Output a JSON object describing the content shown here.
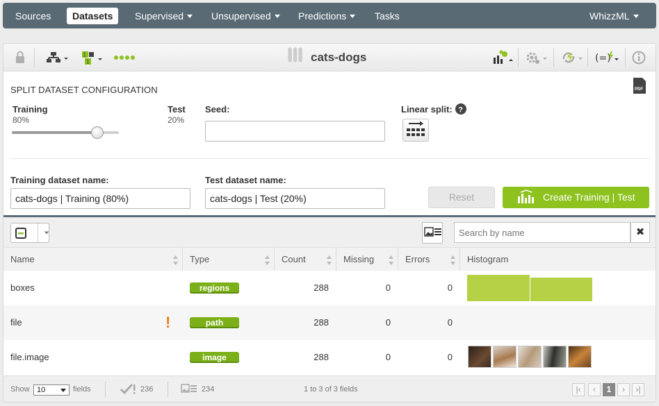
{
  "nav": {
    "sources": "Sources",
    "datasets": "Datasets",
    "supervised": "Supervised",
    "unsupervised": "Unsupervised",
    "predictions": "Predictions",
    "tasks": "Tasks",
    "whizzml": "WhizzML"
  },
  "toolbar": {
    "title": "cats-dogs",
    "status_dots": 4
  },
  "config": {
    "section_title": "SPLIT DATASET CONFIGURATION",
    "training_label": "Training",
    "training_pct": "80%",
    "training_fraction": 0.8,
    "test_label": "Test",
    "test_pct": "20%",
    "seed_label": "Seed:",
    "seed_value": "",
    "linear_split_label": "Linear split:",
    "training_name_label": "Training dataset name:",
    "training_name_value": "cats-dogs | Training (80%)",
    "test_name_label": "Test dataset name:",
    "test_name_value": "cats-dogs | Test (20%)",
    "reset_label": "Reset",
    "create_label": "Create Training | Test"
  },
  "grid": {
    "search_placeholder": "Search by name",
    "columns": [
      "Name",
      "Type",
      "Count",
      "Missing",
      "Errors",
      "Histogram"
    ],
    "rows": [
      {
        "name": "boxes",
        "type": "regions",
        "count": "288",
        "missing": "0",
        "errors": "0",
        "warning": false
      },
      {
        "name": "file",
        "type": "path",
        "count": "288",
        "missing": "0",
        "errors": "0",
        "warning": true
      },
      {
        "name": "file.image",
        "type": "image",
        "count": "288",
        "missing": "0",
        "errors": "0",
        "warning": false
      }
    ]
  },
  "footer": {
    "show_label": "Show",
    "show_value": "10",
    "fields_label": "fields",
    "preferred_count": "236",
    "image_count": "234",
    "range_text": "1 to 3 of 3 fields",
    "current_page": "1"
  },
  "colors": {
    "nav_bg": "#5a6a74",
    "accent_green": "#8dc21f",
    "badge_green": "#7cb018",
    "warning_orange": "#e67e22"
  }
}
